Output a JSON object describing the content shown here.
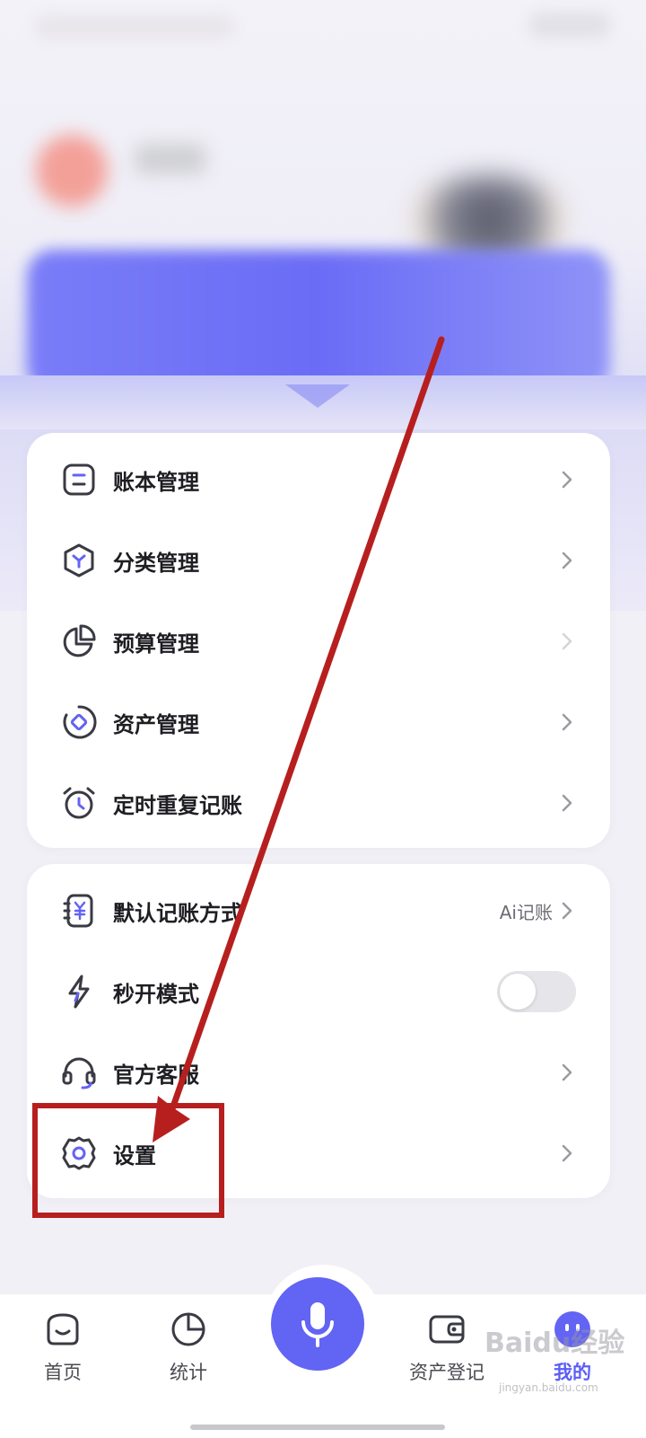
{
  "menu_group_1": [
    {
      "label": "账本管理",
      "icon": "ledger-icon"
    },
    {
      "label": "分类管理",
      "icon": "category-icon"
    },
    {
      "label": "预算管理",
      "icon": "budget-pie-icon"
    },
    {
      "label": "资产管理",
      "icon": "asset-icon"
    },
    {
      "label": "定时重复记账",
      "icon": "alarm-clock-icon"
    }
  ],
  "menu_group_2": {
    "default_method": {
      "label": "默认记账方式",
      "value": "Ai记账",
      "icon": "yuan-note-icon"
    },
    "quick_open": {
      "label": "秒开模式",
      "enabled": false,
      "icon": "lightning-icon"
    },
    "support": {
      "label": "官方客服",
      "icon": "headset-icon"
    },
    "settings": {
      "label": "设置",
      "icon": "gear-icon"
    }
  },
  "bottom_nav": {
    "home": "首页",
    "stats": "统计",
    "assets": "资产登记",
    "mine": "我的"
  },
  "watermark": {
    "text": "Baidu经验",
    "sub": "jingyan.baidu.com"
  },
  "colors": {
    "accent": "#6264f4",
    "annotation": "#b71f1f"
  }
}
